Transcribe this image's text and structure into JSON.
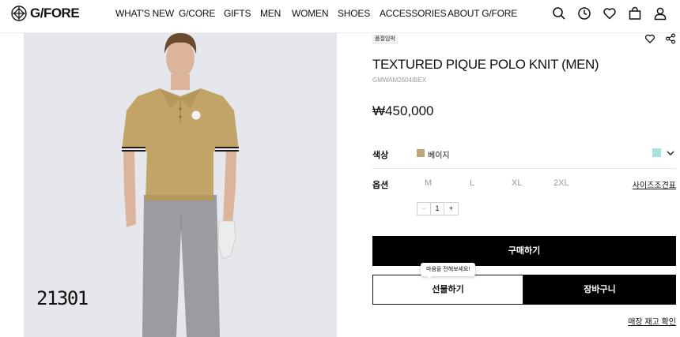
{
  "header": {
    "brand": "G/FORE",
    "nav": [
      {
        "label": "WHAT'S NEW"
      },
      {
        "label": "G/CORE"
      },
      {
        "label": "GIFTS"
      },
      {
        "label": "MEN"
      },
      {
        "label": "WOMEN"
      },
      {
        "label": "SHOES"
      },
      {
        "label": "ACCESSORIES"
      },
      {
        "label": "ABOUT G/FORE"
      }
    ],
    "icons": [
      "search-icon",
      "recent-history-icon",
      "wishlist-heart-icon",
      "shopping-bag-icon",
      "account-icon"
    ]
  },
  "image": {
    "product_number": "21301",
    "colors": {
      "background": "#e6e7ec",
      "shirt": "#c2a468",
      "pants": "#9a9ca0"
    }
  },
  "product": {
    "badge": "품절임박",
    "name": "TEXTURED PIQUE POLO KNIT (MEN)",
    "code": "GMWAM2604IBEX",
    "price": "₩450,000",
    "color_label": "색상",
    "selected_color": "베이지",
    "selected_color_hex": "#c2a475",
    "alt_color_hex": "#a9e3dc",
    "option_label": "옵션",
    "sizes": [
      "M",
      "L",
      "XL",
      "2XL"
    ],
    "size_guide": "사이즈조견표",
    "quantity": "1",
    "qty_minus": "−",
    "qty_plus": "+"
  },
  "actions": {
    "buy": "구매하기",
    "gift": "선물하기",
    "cart": "장바구니",
    "tooltip": "마음을 전해보세요!",
    "stock_check": "매장 재고 확인"
  }
}
